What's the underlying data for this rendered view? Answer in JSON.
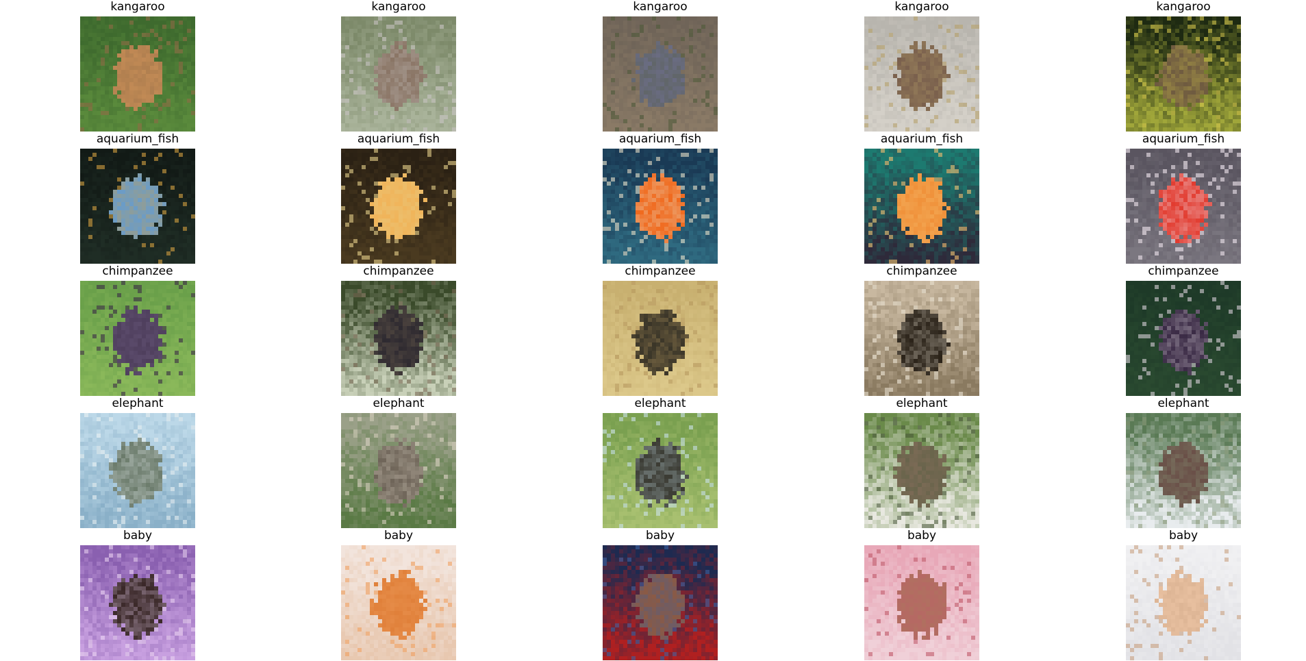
{
  "figure": {
    "rows": [
      {
        "class_name": "kangaroo",
        "images": [
          {
            "title": "kangaroo",
            "palette": {
              "base": "#3e6a2e",
              "mid": "#5a8a3c",
              "subject": "#c18a55",
              "accent": "#8f6a45"
            }
          },
          {
            "title": "kangaroo",
            "palette": {
              "base": "#7d8a6a",
              "mid": "#a9b39a",
              "subject": "#8a7565",
              "accent": "#c6c2c0"
            }
          },
          {
            "title": "kangaroo",
            "palette": {
              "base": "#6f6458",
              "mid": "#8a7a66",
              "subject": "#6a6c82",
              "accent": "#4f5a3a"
            }
          },
          {
            "title": "kangaroo",
            "palette": {
              "base": "#b8b5ae",
              "mid": "#d4d0c8",
              "subject": "#7a604d",
              "accent": "#b5a06a"
            }
          },
          {
            "title": "kangaroo",
            "palette": {
              "base": "#1e2a12",
              "mid": "#a0a63a",
              "subject": "#6e5a40",
              "accent": "#d1c44a"
            }
          }
        ]
      },
      {
        "class_name": "aquarium_fish",
        "images": [
          {
            "title": "aquarium_fish",
            "palette": {
              "base": "#121a16",
              "mid": "#1f2d25",
              "subject": "#6a9cc8",
              "accent": "#d4a040"
            }
          },
          {
            "title": "aquarium_fish",
            "palette": {
              "base": "#2b2114",
              "mid": "#4a3a20",
              "subject": "#f0b45a",
              "accent": "#e6d08a"
            }
          },
          {
            "title": "aquarium_fish",
            "palette": {
              "base": "#1a3a55",
              "mid": "#2f6a80",
              "subject": "#f06a1e",
              "accent": "#e8e0c8"
            }
          },
          {
            "title": "aquarium_fish",
            "palette": {
              "base": "#1d7a70",
              "mid": "#2e2a3a",
              "subject": "#f0913a",
              "accent": "#f5c070"
            }
          },
          {
            "title": "aquarium_fish",
            "palette": {
              "base": "#5a5560",
              "mid": "#7b7780",
              "subject": "#e23b2f",
              "accent": "#f2e8f0"
            }
          }
        ]
      },
      {
        "class_name": "chimpanzee",
        "images": [
          {
            "title": "chimpanzee",
            "palette": {
              "base": "#6aa04a",
              "mid": "#8ab85a",
              "subject": "#5a4a6a",
              "accent": "#3a2a45"
            }
          },
          {
            "title": "chimpanzee",
            "palette": {
              "base": "#3a4a2a",
              "mid": "#c8d0b8",
              "subject": "#2e2a30",
              "accent": "#7a6a55"
            }
          },
          {
            "title": "chimpanzee",
            "palette": {
              "base": "#c8b070",
              "mid": "#dcc88a",
              "subject": "#3a3528",
              "accent": "#b89a60"
            }
          },
          {
            "title": "chimpanzee",
            "palette": {
              "base": "#c8b8a0",
              "mid": "#8a7a60",
              "subject": "#2a2218",
              "accent": "#e8e0d0"
            }
          },
          {
            "title": "chimpanzee",
            "palette": {
              "base": "#1e3a28",
              "mid": "#2a4a30",
              "subject": "#3a2a45",
              "accent": "#d8d0d8"
            }
          }
        ]
      },
      {
        "class_name": "elephant",
        "images": [
          {
            "title": "elephant",
            "palette": {
              "base": "#bcd8e8",
              "mid": "#8ab0c8",
              "subject": "#6a7a6a",
              "accent": "#e8f0f2"
            }
          },
          {
            "title": "elephant",
            "palette": {
              "base": "#9aa088",
              "mid": "#5a7a45",
              "subject": "#6e6458",
              "accent": "#d8d0c0"
            }
          },
          {
            "title": "elephant",
            "palette": {
              "base": "#7aa050",
              "mid": "#a8c070",
              "subject": "#3a3a32",
              "accent": "#c8e0e8"
            }
          },
          {
            "title": "elephant",
            "palette": {
              "base": "#6a8a4a",
              "mid": "#e8e8e0",
              "subject": "#7a6a55",
              "accent": "#4a5a3a"
            }
          },
          {
            "title": "elephant",
            "palette": {
              "base": "#5a7a55",
              "mid": "#e8ecee",
              "subject": "#6a5048",
              "accent": "#8a9a7a"
            }
          }
        ]
      },
      {
        "class_name": "baby",
        "images": [
          {
            "title": "baby",
            "palette": {
              "base": "#8a60b0",
              "mid": "#c8a0e0",
              "subject": "#3a2828",
              "accent": "#e8d0f0"
            }
          },
          {
            "title": "baby",
            "palette": {
              "base": "#f2e4dc",
              "mid": "#e8c8b0",
              "subject": "#e0803a",
              "accent": "#f0a060"
            }
          },
          {
            "title": "baby",
            "palette": {
              "base": "#1e2a50",
              "mid": "#b02020",
              "subject": "#8a5a45",
              "accent": "#3a60a0"
            }
          },
          {
            "title": "baby",
            "palette": {
              "base": "#e8a8b8",
              "mid": "#f0d0d8",
              "subject": "#b07060",
              "accent": "#c05a6a"
            }
          },
          {
            "title": "baby",
            "palette": {
              "base": "#f0f0f2",
              "mid": "#e2e2e6",
              "subject": "#e8c0a0",
              "accent": "#c8a080"
            }
          }
        ]
      }
    ]
  }
}
